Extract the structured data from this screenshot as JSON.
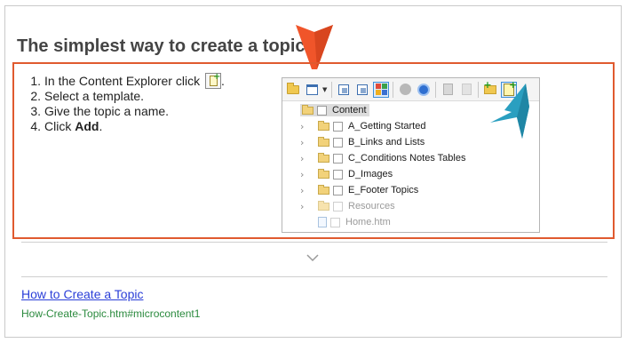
{
  "card": {
    "heading": "The simplest way to create a topic",
    "steps": [
      {
        "num": "1.",
        "text": "In the Content Explorer click",
        "suffix": "."
      },
      {
        "num": "2.",
        "text": "Select a template."
      },
      {
        "num": "3.",
        "text": "Give the topic a name."
      },
      {
        "num": "4.",
        "text": "Click ",
        "bold": "Add",
        "suffix": "."
      }
    ],
    "inline_icon": "new-topic-icon"
  },
  "explorer": {
    "toolbar_icons": [
      "folder-icon",
      "window-icon",
      "dropdown-caret-icon",
      "copy-icon",
      "paste-icon",
      "grid-view-icon",
      "grey-circle-icon",
      "refresh-icon",
      "doc-icon",
      "doc-disabled-icon",
      "new-folder-icon",
      "new-topic-icon"
    ],
    "root": "Content",
    "items": [
      {
        "label": "A_Getting Started",
        "kind": "folder"
      },
      {
        "label": "B_Links and Lists",
        "kind": "folder"
      },
      {
        "label": "C_Conditions Notes Tables",
        "kind": "folder"
      },
      {
        "label": "D_Images",
        "kind": "folder"
      },
      {
        "label": "E_Footer Topics",
        "kind": "folder"
      },
      {
        "label": "Resources",
        "kind": "folder",
        "dim": true
      },
      {
        "label": "Home.htm",
        "kind": "file",
        "dim": true
      }
    ]
  },
  "footer": {
    "link_text": "How to Create a Topic",
    "path_text": "How-Create-Topic.htm#microcontent1"
  },
  "colors": {
    "highlight_border": "#e05a2f",
    "orange_arrow": "#f0552a",
    "cyan_arrow": "#2a9fc0",
    "link": "#2a3ed8",
    "path": "#2b8a3e"
  }
}
